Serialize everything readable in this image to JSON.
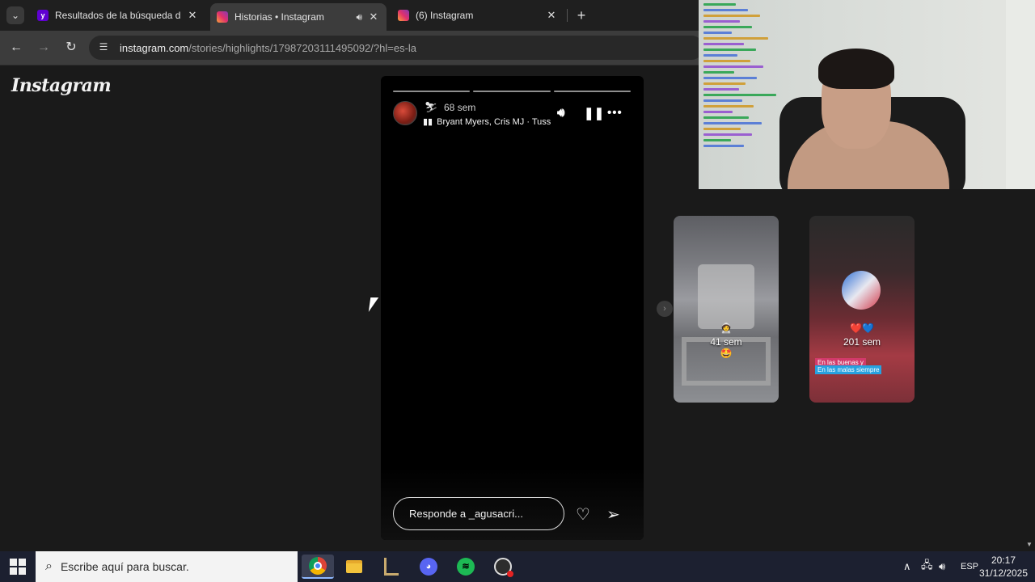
{
  "browser": {
    "tabs": [
      {
        "title": "Resultados de la búsqueda de in",
        "favicon": "yahoo-icon"
      },
      {
        "title": "Historias • Instagram",
        "favicon": "instagram-icon",
        "active": true,
        "audio": true
      },
      {
        "title": "(6) Instagram",
        "favicon": "instagram-icon"
      }
    ],
    "url_host": "instagram.com",
    "url_path": "/stories/highlights/17987203111495092/?hl=es-la"
  },
  "page": {
    "logo": "Instagram",
    "story": {
      "time": "68 sem",
      "music": "Bryant Myers, Cris MJ · Tuss",
      "reply_placeholder": "Responde a _agusacri..."
    },
    "thumbnails": [
      {
        "label": "41 sem"
      },
      {
        "label": "201 sem",
        "sticker_lines": [
          "En las buenas y",
          "En las malas siempre"
        ]
      }
    ]
  },
  "taskbar": {
    "search_placeholder": "Escribe aquí para buscar.",
    "language": "ESP",
    "time": "20:17",
    "date": "31/12/2025"
  },
  "colors": {
    "accent": "#5f01d1",
    "chat_name_colors": [
      "#3aa85a",
      "#5b7fd6",
      "#d0a03a",
      "#9a5fd0"
    ]
  }
}
